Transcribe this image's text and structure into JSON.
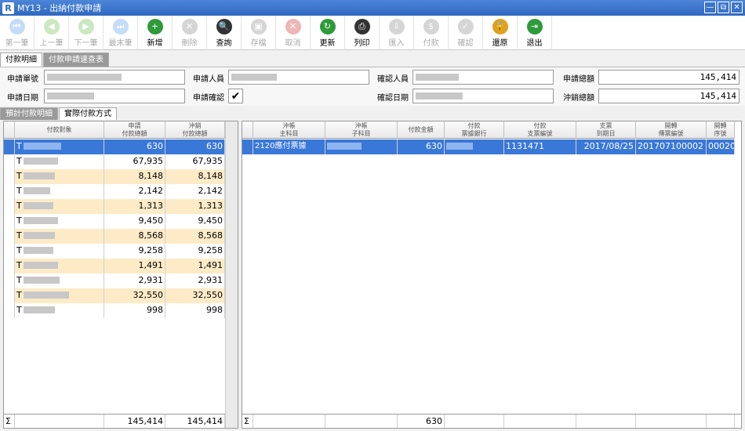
{
  "window": {
    "app_letter": "R",
    "title": "MY13 - 出納付款申請",
    "controls": [
      "—",
      "⧉",
      "✕"
    ]
  },
  "toolbar": [
    {
      "label": "第一筆",
      "icon": "first-record-icon",
      "enabled": false,
      "color": "#5aa0e6",
      "glyph": "⏮"
    },
    {
      "label": "上一筆",
      "icon": "previous-record-icon",
      "enabled": false,
      "color": "#6cbf4c",
      "glyph": "◀"
    },
    {
      "label": "下一筆",
      "icon": "next-record-icon",
      "enabled": false,
      "color": "#6cbf4c",
      "glyph": "▶"
    },
    {
      "label": "最末筆",
      "icon": "last-record-icon",
      "enabled": false,
      "color": "#5aa0e6",
      "glyph": "⏭"
    },
    {
      "label": "新增",
      "icon": "add-document-icon",
      "enabled": true,
      "color": "#2e9a3a",
      "glyph": "+"
    },
    {
      "label": "刪除",
      "icon": "delete-document-icon",
      "enabled": false,
      "color": "#888888",
      "glyph": "✕"
    },
    {
      "label": "查詢",
      "icon": "search-icon",
      "enabled": true,
      "color": "#333333",
      "glyph": "🔍"
    },
    {
      "label": "存檔",
      "icon": "save-icon",
      "enabled": false,
      "color": "#888888",
      "glyph": "▣"
    },
    {
      "label": "取消",
      "icon": "cancel-icon",
      "enabled": false,
      "color": "#d03030",
      "glyph": "✕"
    },
    {
      "label": "更新",
      "icon": "refresh-icon",
      "enabled": true,
      "color": "#2e9a3a",
      "glyph": "↻"
    },
    {
      "label": "列印",
      "icon": "printer-icon",
      "enabled": true,
      "color": "#333333",
      "glyph": "⎙"
    },
    {
      "label": "匯入",
      "icon": "import-icon",
      "enabled": false,
      "color": "#888888",
      "glyph": "⇩"
    },
    {
      "label": "付款",
      "icon": "payment-icon",
      "enabled": false,
      "color": "#888888",
      "glyph": "$"
    },
    {
      "label": "確認",
      "icon": "confirm-icon",
      "enabled": false,
      "color": "#888888",
      "glyph": "✓"
    },
    {
      "label": "還原",
      "icon": "restore-lock-icon",
      "enabled": true,
      "color": "#e0a020",
      "glyph": "🔓"
    },
    {
      "label": "退出",
      "icon": "exit-door-icon",
      "enabled": true,
      "color": "#2e9a3a",
      "glyph": "⇥"
    }
  ],
  "tabs_top": [
    {
      "label": "付款明細",
      "active": true
    },
    {
      "label": "付款申請速查表",
      "active": false
    }
  ],
  "form": {
    "apply_no_label": "申請單號",
    "applicant_label": "申請人員",
    "confirmer_label": "確認人員",
    "apply_total_label": "申請總額",
    "apply_total": "145,414",
    "apply_date_label": "申請日期",
    "apply_confirm_label": "申請確認",
    "confirm_date_label": "確認日期",
    "writeoff_total_label": "沖銷總額",
    "writeoff_total": "145,414",
    "apply_confirm_checked": true
  },
  "tabs_bottom": [
    {
      "label": "預計付款明細",
      "active": false
    },
    {
      "label": "實際付款方式",
      "active": true
    }
  ],
  "left_grid": {
    "headers": [
      "付款對象",
      "申請\n付款總額",
      "沖銷\n付款總額"
    ],
    "rows": [
      {
        "prefix": "T",
        "apply": "630",
        "writeoff": "630"
      },
      {
        "prefix": "T",
        "apply": "67,935",
        "writeoff": "67,935"
      },
      {
        "prefix": "T",
        "apply": "8,148",
        "writeoff": "8,148"
      },
      {
        "prefix": "T",
        "apply": "2,142",
        "writeoff": "2,142"
      },
      {
        "prefix": "T",
        "apply": "1,313",
        "writeoff": "1,313"
      },
      {
        "prefix": "T",
        "apply": "9,450",
        "writeoff": "9,450"
      },
      {
        "prefix": "T",
        "apply": "8,568",
        "writeoff": "8,568"
      },
      {
        "prefix": "T",
        "apply": "9,258",
        "writeoff": "9,258"
      },
      {
        "prefix": "T",
        "apply": "1,491",
        "writeoff": "1,491"
      },
      {
        "prefix": "T",
        "apply": "2,931",
        "writeoff": "2,931"
      },
      {
        "prefix": "T",
        "apply": "32,550",
        "writeoff": "32,550"
      },
      {
        "prefix": "T",
        "apply": "998",
        "writeoff": "998"
      }
    ],
    "footer": {
      "sigma": "Σ",
      "apply": "145,414",
      "writeoff": "145,414"
    }
  },
  "right_grid": {
    "headers": [
      "沖帳\n主科目",
      "沖帳\n子科目",
      "付款金額",
      "付款\n票據銀行",
      "付款\n支票編號",
      "支票\n到期日",
      "開轉\n傳票編號",
      "開轉\n序號"
    ],
    "rows": [
      {
        "main_account": "2120應付票據",
        "amount": "630",
        "check_no": "1131471",
        "due_date": "2017/08/25",
        "voucher_no": "201707100002",
        "seq": "00020"
      }
    ],
    "footer": {
      "sigma": "Σ",
      "amount": "630"
    }
  },
  "colors": {
    "title_bar": "#2f68c0",
    "selected_row": "#3a78d8",
    "alt_row": "#fdebc8"
  }
}
